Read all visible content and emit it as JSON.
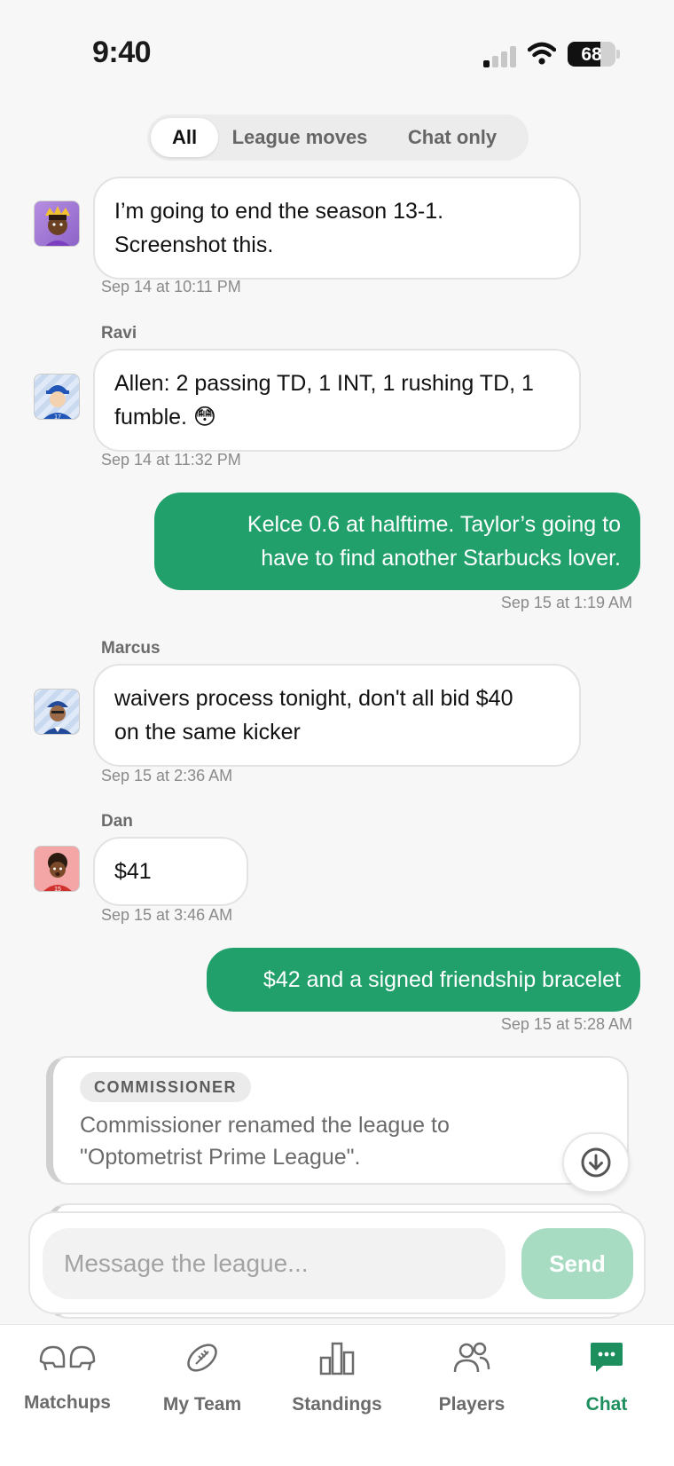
{
  "status_bar": {
    "time": "9:40",
    "battery": "68",
    "battery_level": 0.68
  },
  "filter": {
    "tabs": [
      "All",
      "League moves",
      "Chat only"
    ],
    "active": "All"
  },
  "messages": [
    {
      "sender": "",
      "text_lines": [
        "I’m going to end the season 13-1.",
        "Screenshot this."
      ],
      "timestamp": "Sep 14 at 10:11 PM"
    },
    {
      "sender": "Ravi",
      "text_lines": [
        "Allen: 2 passing TD, 1 INT, 1 rushing TD, 1",
        "fumble. 😳"
      ],
      "timestamp": "Sep 14 at 11:32 PM"
    },
    {
      "sender": "",
      "outgoing": true,
      "text_lines": [
        "Kelce 0.6 at halftime. Taylor’s going to",
        "have to find another Starbucks lover."
      ],
      "timestamp": "Sep 15 at 1:19 AM"
    },
    {
      "sender": "Marcus",
      "text_lines": [
        "waivers process tonight, don't all bid $40",
        "on the same kicker"
      ],
      "timestamp": "Sep 15 at 2:36 AM"
    },
    {
      "sender": "Dan",
      "text_lines": [
        "$41"
      ],
      "timestamp": "Sep 15 at 3:46 AM"
    },
    {
      "sender": "",
      "outgoing": true,
      "text_lines": [
        "$42 and a signed friendship bracelet"
      ],
      "timestamp": "Sep 15 at 5:28 AM"
    }
  ],
  "commissioner_note": {
    "badge": "COMMISSIONER",
    "text_lines": [
      "Commissioner renamed the league to",
      "\"Optometrist Prime League\"."
    ]
  },
  "composer": {
    "placeholder": "Message the league...",
    "send_label": "Send"
  },
  "tabbar": {
    "items": [
      {
        "label": "Matchups",
        "icon": "helmets-icon"
      },
      {
        "label": "My Team",
        "icon": "football-icon"
      },
      {
        "label": "Standings",
        "icon": "bar-chart-icon"
      },
      {
        "label": "Players",
        "icon": "people-icon"
      },
      {
        "label": "Chat",
        "icon": "chat-icon"
      }
    ],
    "active": "Chat"
  },
  "colors": {
    "accent": "#22a06b",
    "accent_dark": "#1d8f5e",
    "send_disabled": "#a7dcc3"
  }
}
